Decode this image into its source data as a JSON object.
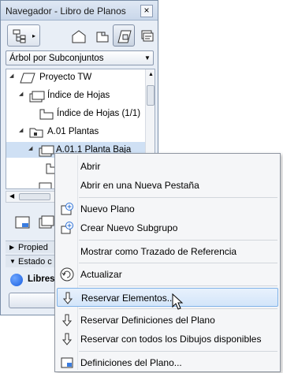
{
  "window": {
    "title": "Navegador - Libro de Planos",
    "close_glyph": "×"
  },
  "toolbar": {
    "map_button_icon": "map-tree-icon",
    "arrow": "▸",
    "buttons": [
      "project-map-icon",
      "view-map-icon",
      "layout-book-icon",
      "publisher-icon"
    ]
  },
  "dropdown": {
    "value": "Árbol por Subconjuntos",
    "arrow": "▼"
  },
  "tree": {
    "nodes": [
      {
        "label": "Proyecto TW",
        "toggle": "◢"
      },
      {
        "label": "Índice de Hojas",
        "toggle": "◢"
      },
      {
        "label": "Índice de Hojas (1/1)",
        "toggle": ""
      },
      {
        "label": "A.01 Plantas",
        "toggle": "◢"
      },
      {
        "label": "A.01.1 Planta Baja",
        "toggle": "◢"
      }
    ],
    "scroll_up": "▲"
  },
  "hscroll": {
    "left_arrow": "◀"
  },
  "sections": {
    "properties": {
      "label": "Propied",
      "toggle": "▶"
    },
    "status": {
      "label": "Estado c",
      "toggle": "▼"
    }
  },
  "status": {
    "label": "Libres",
    "color": "#1a5fe0"
  },
  "colors": {
    "highlight_border": "#7fb2e8",
    "selection": "#cfe0f4"
  },
  "menu": {
    "items": [
      {
        "label": "Abrir",
        "icon": ""
      },
      {
        "label": "Abrir en una Nueva Pestaña",
        "icon": ""
      },
      {
        "label": "Nuevo Plano",
        "icon": "new-layout-icon"
      },
      {
        "label": "Crear Nuevo Subgrupo",
        "icon": "new-subset-icon"
      },
      {
        "label": "Mostrar como Trazado de Referencia",
        "icon": ""
      },
      {
        "label": "Actualizar",
        "icon": "refresh-icon"
      },
      {
        "label": "Reservar Elementos...",
        "icon": "reserve-arrow-icon",
        "highlighted": true
      },
      {
        "label": "Reservar Definiciones del Plano",
        "icon": "reserve-arrow-icon"
      },
      {
        "label": "Reservar con todos los Dibujos disponibles",
        "icon": "reserve-arrow-icon"
      },
      {
        "label": "Definiciones del Plano...",
        "icon": "layout-settings-icon"
      }
    ]
  }
}
